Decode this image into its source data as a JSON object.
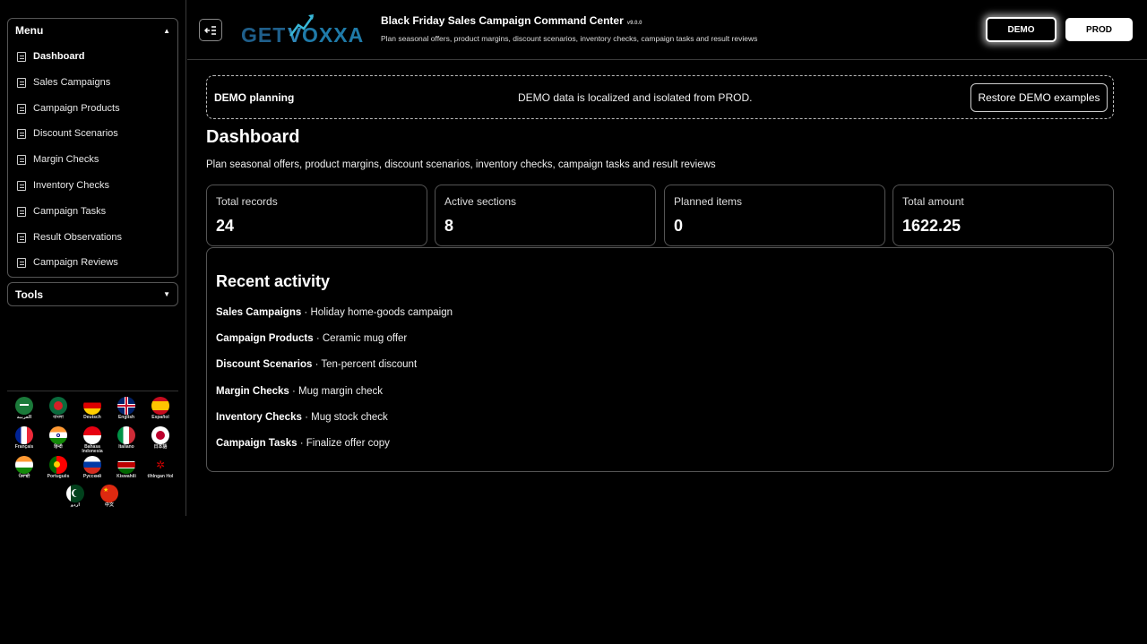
{
  "sidebar": {
    "menu_title": "Menu",
    "items": [
      {
        "label": "Dashboard"
      },
      {
        "label": "Sales Campaigns"
      },
      {
        "label": "Campaign Products"
      },
      {
        "label": "Discount Scenarios"
      },
      {
        "label": "Margin Checks"
      },
      {
        "label": "Inventory Checks"
      },
      {
        "label": "Campaign Tasks"
      },
      {
        "label": "Result Observations"
      },
      {
        "label": "Campaign Reviews"
      }
    ],
    "active_item": "Dashboard",
    "tools_title": "Tools",
    "languages": [
      {
        "label": "العربية"
      },
      {
        "label": "বাংলা"
      },
      {
        "label": "Deutsch"
      },
      {
        "label": "English"
      },
      {
        "label": "Español"
      },
      {
        "label": "Français"
      },
      {
        "label": "हिन्दी"
      },
      {
        "label": "Bahasa Indonesia"
      },
      {
        "label": "Italiano"
      },
      {
        "label": "日本語"
      },
      {
        "label": "ਪੰਜਾਬੀ"
      },
      {
        "label": "Português"
      },
      {
        "label": "Русский"
      },
      {
        "label": "Kiswahili"
      },
      {
        "label": "tlhIngan Hol"
      },
      {
        "label": "اردو"
      },
      {
        "label": "中文"
      }
    ]
  },
  "header": {
    "logo_text": "GETVOXXA",
    "title": "Black Friday Sales Campaign Command Center",
    "version": "v9.0.0",
    "subtitle": "Plan seasonal offers, product margins, discount scenarios, inventory checks, campaign tasks and result reviews",
    "env_demo": "DEMO",
    "env_prod": "PROD"
  },
  "banner": {
    "title": "DEMO planning",
    "message": "DEMO data is localized and isolated from PROD.",
    "restore_label": "Restore DEMO examples"
  },
  "page": {
    "title": "Dashboard",
    "subtitle": "Plan seasonal offers, product margins, discount scenarios, inventory checks, campaign tasks and result reviews"
  },
  "stats": [
    {
      "label": "Total records",
      "value": "24"
    },
    {
      "label": "Active sections",
      "value": "8"
    },
    {
      "label": "Planned items",
      "value": "0"
    },
    {
      "label": "Total amount",
      "value": "1622.25"
    }
  ],
  "activity": {
    "title": "Recent activity",
    "items": [
      {
        "section": "Sales Campaigns",
        "sep": " · ",
        "text": "Holiday home-goods campaign"
      },
      {
        "section": "Campaign Products",
        "sep": " · ",
        "text": "Ceramic mug offer"
      },
      {
        "section": "Discount Scenarios",
        "sep": " · ",
        "text": "Ten-percent discount"
      },
      {
        "section": "Margin Checks",
        "sep": " · ",
        "text": "Mug margin check"
      },
      {
        "section": "Inventory Checks",
        "sep": " · ",
        "text": "Mug stock check"
      },
      {
        "section": "Campaign Tasks",
        "sep": " · ",
        "text": "Finalize offer copy"
      }
    ]
  },
  "colors": {
    "background": "#000000",
    "border": "#555555",
    "logo_blue": "#1f5f8b",
    "logo_cyan": "#39b8d8"
  }
}
